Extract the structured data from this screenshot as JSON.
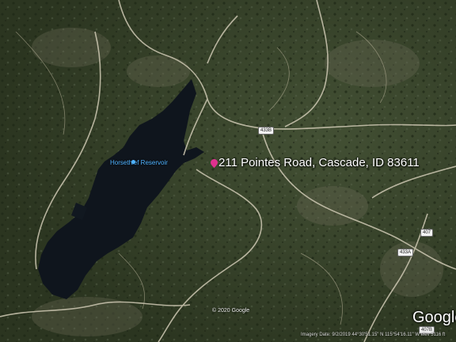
{
  "map": {
    "place_label": "211 Pointes Road, Cascade, ID 83611",
    "water_label": "Horsethief Reservoir",
    "copyright": "© 2020 Google",
    "road_labels": [
      "433B",
      "407",
      "433A",
      "407B"
    ],
    "attribution": {
      "imagery_date": "Imagery Date: 9/2/2019",
      "coordinates": "44°30'51.15\" N  115°54'16.11\" W",
      "elevation": "elev  5116 ft"
    },
    "logo": "Google",
    "colors": {
      "water": "#0f151d",
      "forest": "#2f3b24",
      "road": "#cfc9b4",
      "pin": "#e0318f",
      "water_label": "#4fb2ff"
    }
  }
}
